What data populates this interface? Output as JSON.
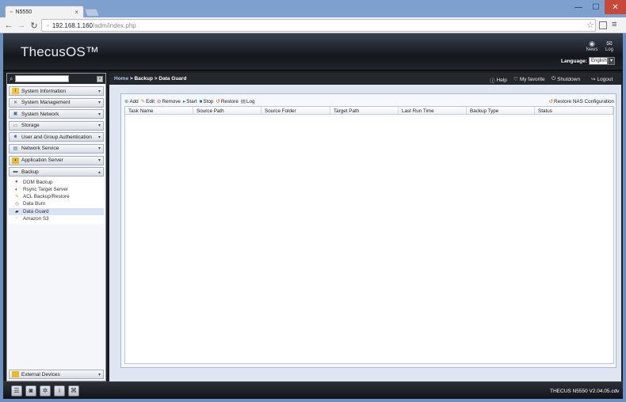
{
  "browser": {
    "tab_title": "N5550",
    "tab_close": "×",
    "url_host": "192.168.1.160",
    "url_path": "/adm/index.php",
    "controls": {
      "minimize": "—",
      "maximize": "☐",
      "close": "✕"
    }
  },
  "header": {
    "logo": "ThecusOS™",
    "news_label": "News",
    "log_label": "Log",
    "language_label": "Language:",
    "language_value": "English"
  },
  "sidebar": {
    "search_placeholder": "",
    "menu": [
      {
        "label": "System Information",
        "icon": "info-icon"
      },
      {
        "label": "System Management",
        "icon": "tools-icon"
      },
      {
        "label": "System Network",
        "icon": "network-icon"
      },
      {
        "label": "Storage",
        "icon": "storage-icon"
      },
      {
        "label": "User and Group Authentication",
        "icon": "users-icon"
      },
      {
        "label": "Network Service",
        "icon": "network-service-icon"
      },
      {
        "label": "Application Server",
        "icon": "app-server-icon"
      },
      {
        "label": "Backup",
        "icon": "backup-icon"
      }
    ],
    "backup_sub": [
      "DOM Backup",
      "Rsync Target Server",
      "ACL Backup/Restore",
      "Data Burn",
      "Data Guard",
      "Amazon S3"
    ],
    "external_devices": "External Devices"
  },
  "breadcrumb": {
    "home": "Home",
    "sep1": " > ",
    "section": "Backup",
    "sep2": " > ",
    "page": "Data Guard"
  },
  "top_actions": {
    "help": "Help",
    "favorite": "My favorite",
    "shutdown": "Shutdown",
    "logout": "Logout"
  },
  "toolbar": {
    "add": "Add",
    "edit": "Edit",
    "remove": "Remove",
    "start": "Start",
    "stop": "Stop",
    "restore": "Restore",
    "log": "Log",
    "restore_nas": "Restore NAS Configuration"
  },
  "grid": {
    "columns": [
      "Task Name",
      "Source Path",
      "Source Folder",
      "Target Path",
      "Last Run Time",
      "Backup Type",
      "Status"
    ]
  },
  "footer": {
    "version": "THECUS N5550 V2.04.05.cdv"
  }
}
